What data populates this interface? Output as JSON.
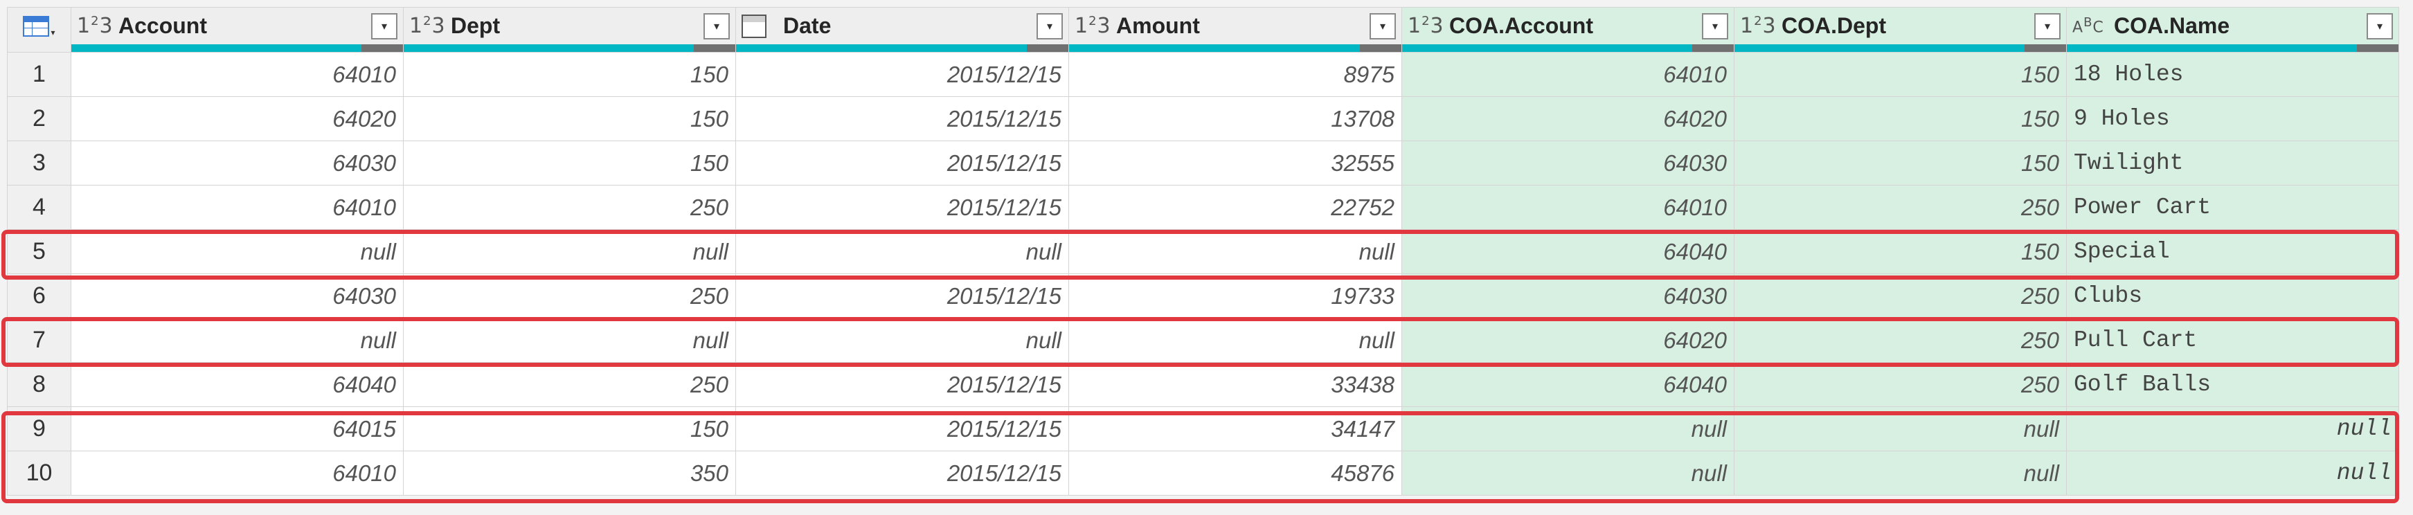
{
  "columns": [
    {
      "name": "Account",
      "type_icon": "whole-number-icon",
      "type_glyph": "1²3"
    },
    {
      "name": "Dept",
      "type_icon": "whole-number-icon",
      "type_glyph": "1²3"
    },
    {
      "name": "Date",
      "type_icon": "calendar-icon",
      "type_glyph": ""
    },
    {
      "name": "Amount",
      "type_icon": "whole-number-icon",
      "type_glyph": "1²3"
    },
    {
      "name": "COA.Account",
      "type_icon": "whole-number-icon",
      "type_glyph": "1²3"
    },
    {
      "name": "COA.Dept",
      "type_icon": "whole-number-icon",
      "type_glyph": "1²3"
    },
    {
      "name": "COA.Name",
      "type_icon": "text-type-icon",
      "type_glyph": "ABC"
    }
  ],
  "colors": {
    "highlight": "#e0383e",
    "merged_column_bg": "#d7f0e1",
    "quality_bar": "#00b7c3"
  },
  "rows": [
    {
      "num": "1",
      "cells": [
        "64010",
        "150",
        "2015/12/15",
        "8975",
        "64010",
        "150",
        "18 Holes"
      ]
    },
    {
      "num": "2",
      "cells": [
        "64020",
        "150",
        "2015/12/15",
        "13708",
        "64020",
        "150",
        "9 Holes"
      ]
    },
    {
      "num": "3",
      "cells": [
        "64030",
        "150",
        "2015/12/15",
        "32555",
        "64030",
        "150",
        "Twilight"
      ]
    },
    {
      "num": "4",
      "cells": [
        "64010",
        "250",
        "2015/12/15",
        "22752",
        "64010",
        "250",
        "Power Cart"
      ]
    },
    {
      "num": "5",
      "cells": [
        "null",
        "null",
        "null",
        "null",
        "64040",
        "150",
        "Special"
      ]
    },
    {
      "num": "6",
      "cells": [
        "64030",
        "250",
        "2015/12/15",
        "19733",
        "64030",
        "250",
        "Clubs"
      ]
    },
    {
      "num": "7",
      "cells": [
        "null",
        "null",
        "null",
        "null",
        "64020",
        "250",
        "Pull Cart"
      ]
    },
    {
      "num": "8",
      "cells": [
        "64040",
        "250",
        "2015/12/15",
        "33438",
        "64040",
        "250",
        "Golf Balls"
      ]
    },
    {
      "num": "9",
      "cells": [
        "64015",
        "150",
        "2015/12/15",
        "34147",
        "null",
        "null",
        "null"
      ]
    },
    {
      "num": "10",
      "cells": [
        "64010",
        "350",
        "2015/12/15",
        "45876",
        "null",
        "null",
        "null"
      ]
    }
  ]
}
